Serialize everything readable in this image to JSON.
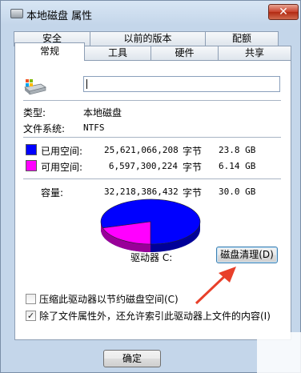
{
  "window": {
    "title": "本地磁盘 属性",
    "close_glyph": "✕"
  },
  "tabs_row1": [
    "安全",
    "以前的版本",
    "配额"
  ],
  "tabs_row2": [
    "常规",
    "工具",
    "硬件",
    "共享"
  ],
  "general": {
    "name_value": "",
    "type_label": "类型:",
    "type_value": "本地磁盘",
    "fs_label": "文件系统:",
    "fs_value": "NTFS",
    "used": {
      "label": "已用空间:",
      "bytes": "25,621,066,208",
      "unit": "字节",
      "size": "23.8 GB",
      "color": "#0000ff"
    },
    "free": {
      "label": "可用空间:",
      "bytes": "6,597,300,224",
      "unit": "字节",
      "size": "6.14 GB",
      "color": "#ff00ff"
    },
    "capacity": {
      "label": "容量:",
      "bytes": "32,218,386,432",
      "unit": "字节",
      "size": "30.0 GB"
    },
    "drive_label": "驱动器 C:",
    "cleanup_button": "磁盘清理(D)",
    "compress_option": {
      "label": "压缩此驱动器以节约磁盘空间(C)",
      "checked": false
    },
    "index_option": {
      "label": "除了文件属性外，还允许索引此驱动器上文件的内容(I)",
      "checked": true,
      "check_glyph": "✓"
    }
  },
  "chart_data": {
    "type": "pie",
    "categories": [
      "已用空间",
      "可用空间"
    ],
    "values": [
      25621066208,
      6597300224
    ],
    "colors": [
      "#0000ff",
      "#ff00ff"
    ]
  },
  "footer": {
    "ok_button": "确定"
  },
  "annotation": {
    "arrow_color": "#e8402a"
  }
}
